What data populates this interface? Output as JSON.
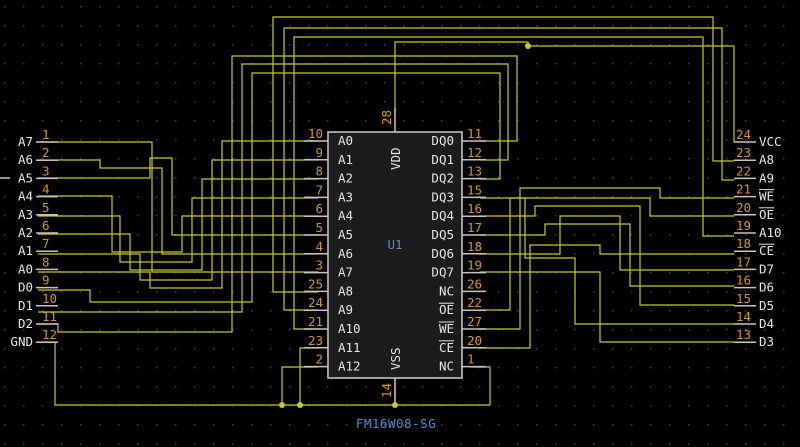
{
  "component": {
    "reference": "U1",
    "value": "FM16W08-SG",
    "left_pins": [
      {
        "num": "10",
        "name": "A0"
      },
      {
        "num": "9",
        "name": "A1"
      },
      {
        "num": "8",
        "name": "A2"
      },
      {
        "num": "7",
        "name": "A3"
      },
      {
        "num": "6",
        "name": "A4"
      },
      {
        "num": "5",
        "name": "A5"
      },
      {
        "num": "4",
        "name": "A6"
      },
      {
        "num": "3",
        "name": "A7"
      },
      {
        "num": "25",
        "name": "A8"
      },
      {
        "num": "24",
        "name": "A9"
      },
      {
        "num": "21",
        "name": "A10"
      },
      {
        "num": "23",
        "name": "A11"
      },
      {
        "num": "2",
        "name": "A12"
      }
    ],
    "right_pins": [
      {
        "num": "11",
        "name": "DQ0"
      },
      {
        "num": "12",
        "name": "DQ1"
      },
      {
        "num": "13",
        "name": "DQ2"
      },
      {
        "num": "15",
        "name": "DQ3"
      },
      {
        "num": "16",
        "name": "DQ4"
      },
      {
        "num": "17",
        "name": "DQ5"
      },
      {
        "num": "18",
        "name": "DQ6"
      },
      {
        "num": "19",
        "name": "DQ7"
      },
      {
        "num": "26",
        "name": "NC",
        "overbar": false
      },
      {
        "num": "22",
        "name": "OE",
        "overbar": true
      },
      {
        "num": "27",
        "name": "WE",
        "overbar": true
      },
      {
        "num": "20",
        "name": "CE",
        "overbar": true
      },
      {
        "num": "1",
        "name": "NC",
        "overbar": false
      }
    ],
    "top_pin": {
      "num": "28",
      "name": "VDD"
    },
    "bottom_pin": {
      "num": "14",
      "name": "VSS"
    }
  },
  "left_connector": [
    {
      "num": "1",
      "net": "A7"
    },
    {
      "num": "2",
      "net": "A6"
    },
    {
      "num": "3",
      "net": "A5"
    },
    {
      "num": "4",
      "net": "A4"
    },
    {
      "num": "5",
      "net": "A3"
    },
    {
      "num": "6",
      "net": "A2"
    },
    {
      "num": "7",
      "net": "A1"
    },
    {
      "num": "8",
      "net": "A0"
    },
    {
      "num": "9",
      "net": "D0"
    },
    {
      "num": "10",
      "net": "D1"
    },
    {
      "num": "11",
      "net": "D2"
    },
    {
      "num": "12",
      "net": "GND"
    }
  ],
  "right_connector": [
    {
      "num": "24",
      "net": "VCC",
      "overbar": false
    },
    {
      "num": "23",
      "net": "A8",
      "overbar": false
    },
    {
      "num": "22",
      "net": "A9",
      "overbar": false
    },
    {
      "num": "21",
      "net": "WE",
      "overbar": true
    },
    {
      "num": "20",
      "net": "OE",
      "overbar": true
    },
    {
      "num": "19",
      "net": "A10",
      "overbar": false
    },
    {
      "num": "18",
      "net": "CE",
      "overbar": true
    },
    {
      "num": "17",
      "net": "D7",
      "overbar": false
    },
    {
      "num": "16",
      "net": "D6",
      "overbar": false
    },
    {
      "num": "15",
      "net": "D5",
      "overbar": false
    },
    {
      "num": "14",
      "net": "D4",
      "overbar": false
    },
    {
      "num": "13",
      "net": "D3",
      "overbar": false
    }
  ],
  "colors": {
    "background": "#000000",
    "wire": "#c8c832",
    "pin_number": "#d89528",
    "pin_name": "#e6e6e6",
    "component_text": "#4f8fd6",
    "body_fill": "#1c1c1c",
    "outline": "#c4c4c4"
  }
}
